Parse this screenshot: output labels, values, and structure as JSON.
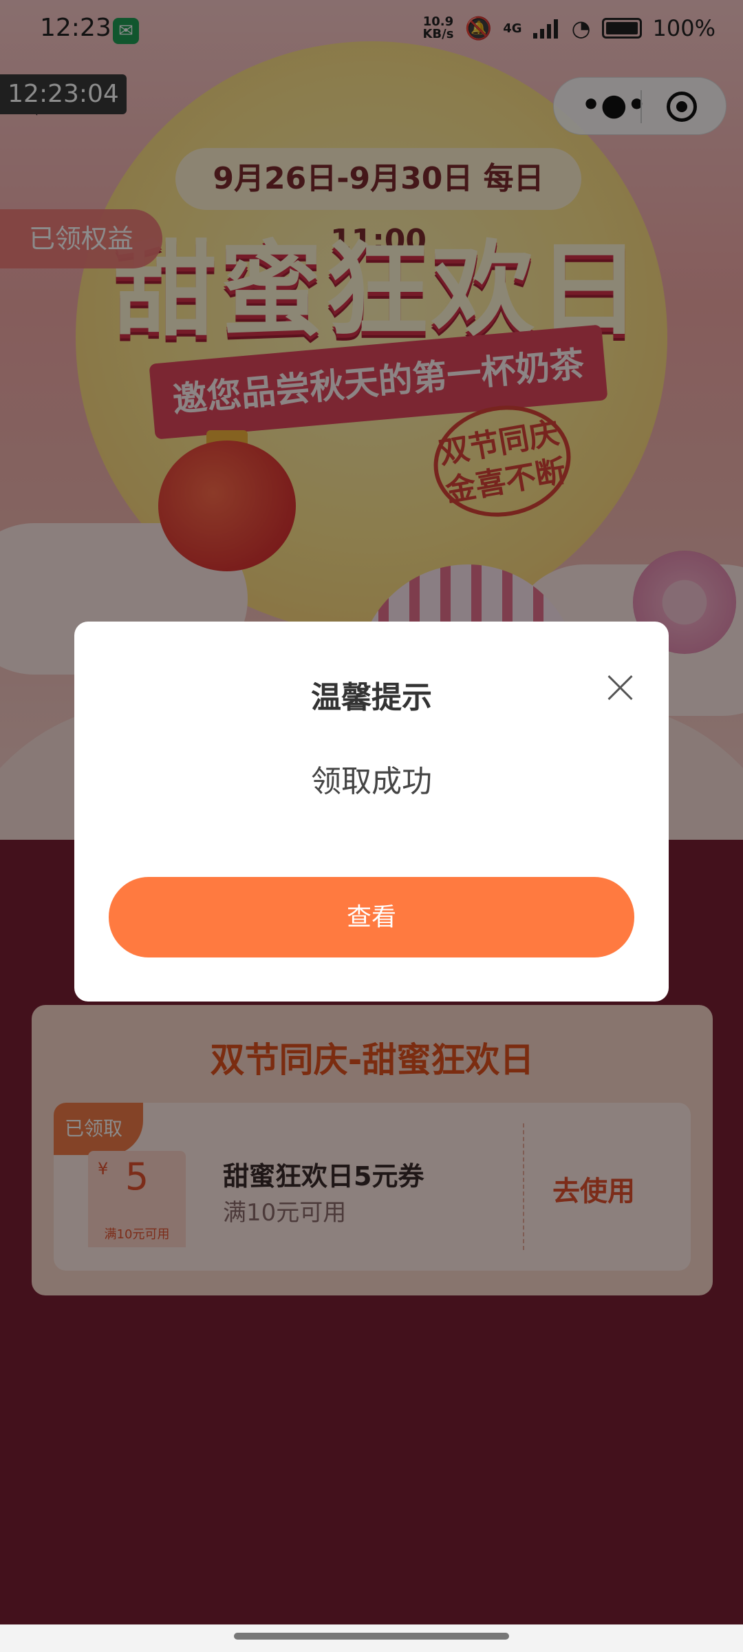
{
  "status_bar": {
    "time": "12:23",
    "net_speed_value": "10.9",
    "net_speed_unit": "KB/s",
    "network": "4G",
    "battery": "100%"
  },
  "overlay_clock": "12:23:04",
  "header": {
    "benefit_tag": "已领权益"
  },
  "banner": {
    "date_range": "9月26日-9月30日 每日11:00",
    "headline": "甜蜜狂欢日",
    "subtitle": "邀您品尝秋天的第一杯奶茶",
    "stamp_line1": "双节同庆",
    "stamp_line2": "金喜不断"
  },
  "coupon_panel": {
    "title": "双节同庆-甜蜜狂欢日",
    "coupon": {
      "badge": "已领取",
      "currency": "¥",
      "amount": "5",
      "condition_small": "满10元可用",
      "name": "甜蜜狂欢日5元券",
      "condition": "满10元可用",
      "action": "去使用"
    }
  },
  "dialog": {
    "title": "温馨提示",
    "message": "领取成功",
    "button": "查看"
  }
}
